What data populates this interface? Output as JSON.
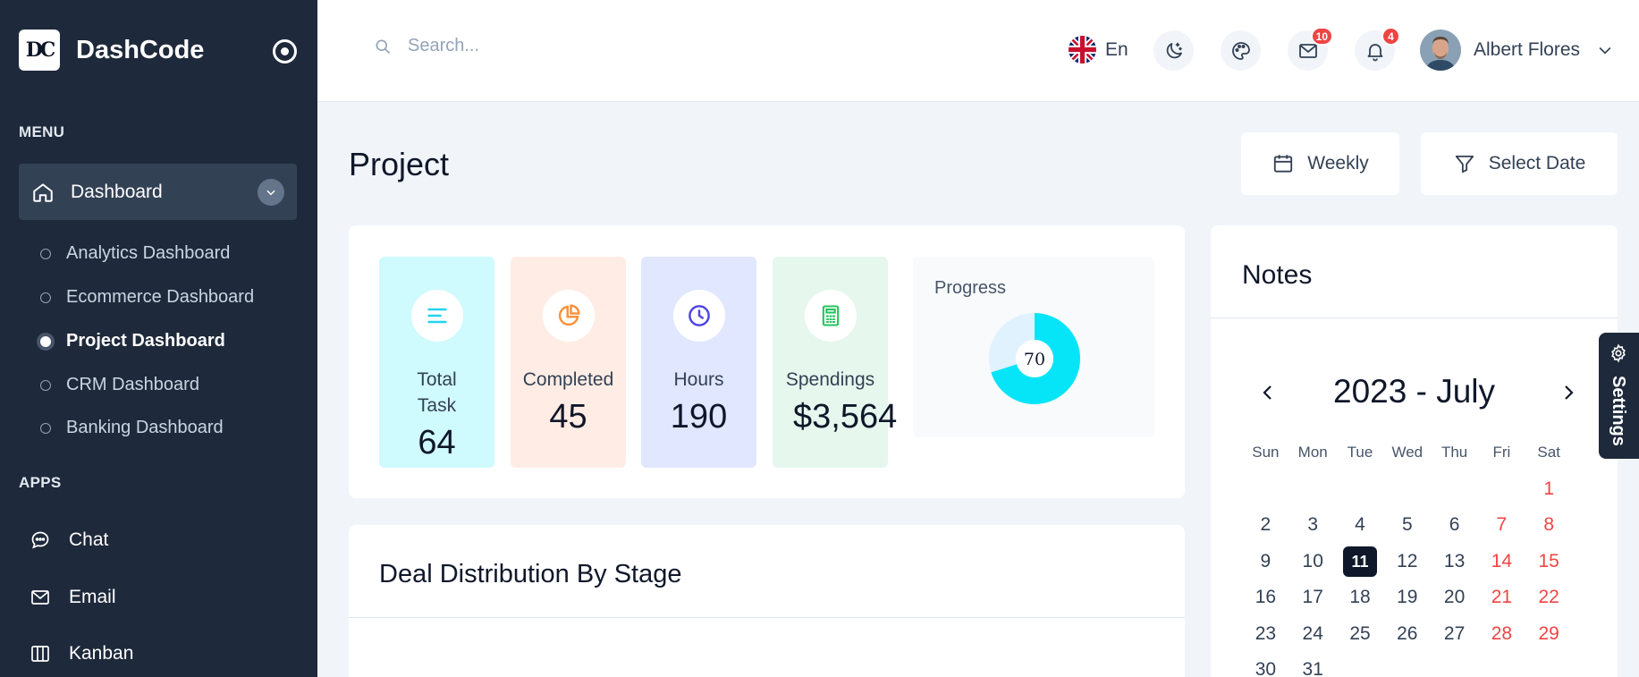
{
  "brand": {
    "logo_text": "DC",
    "name": "DashCode"
  },
  "sidebar": {
    "menu_title": "MENU",
    "dashboard_label": "Dashboard",
    "sub_items": [
      {
        "label": "Analytics Dashboard"
      },
      {
        "label": "Ecommerce Dashboard"
      },
      {
        "label": "Project Dashboard",
        "active": true
      },
      {
        "label": "CRM Dashboard"
      },
      {
        "label": "Banking Dashboard"
      }
    ],
    "apps_title": "APPS",
    "apps": [
      {
        "label": "Chat",
        "icon": "chat-icon"
      },
      {
        "label": "Email",
        "icon": "mail-icon"
      },
      {
        "label": "Kanban",
        "icon": "kanban-icon"
      }
    ]
  },
  "header": {
    "search_placeholder": "Search...",
    "language": "En",
    "mail_count": "10",
    "notification_count": "4",
    "user_name": "Albert Flores"
  },
  "page": {
    "title": "Project",
    "weekly_label": "Weekly",
    "select_date_label": "Select Date"
  },
  "stats": [
    {
      "label": "Total Task",
      "value": "64",
      "bg": "#cffafe",
      "icon": "list-icon",
      "icon_color": "#22d3ee"
    },
    {
      "label": "Completed",
      "value": "45",
      "bg": "#ffede5",
      "icon": "pie-chart-icon",
      "icon_color": "#fb923c"
    },
    {
      "label": "Hours",
      "value": "190",
      "bg": "#e0e7ff",
      "icon": "clock-icon",
      "icon_color": "#4f46e5"
    },
    {
      "label": "Spendings",
      "value": "$3,564",
      "bg": "#e6f7ee",
      "icon": "calculator-icon",
      "icon_color": "#22c55e"
    }
  ],
  "progress": {
    "label": "Progress",
    "value": "70",
    "percent": 70,
    "color": "#06e5f8",
    "track": "#e0f2fe"
  },
  "deal": {
    "title": "Deal Distribution By Stage"
  },
  "notes": {
    "title": "Notes",
    "calendar_title": "2023 - July",
    "days_of_week": [
      "Sun",
      "Mon",
      "Tue",
      "Wed",
      "Thu",
      "Fri",
      "Sat"
    ],
    "weeks": [
      [
        "",
        "",
        "",
        "",
        "",
        "",
        "1"
      ],
      [
        "2",
        "3",
        "4",
        "5",
        "6",
        "7",
        "8"
      ],
      [
        "9",
        "10",
        "11",
        "12",
        "13",
        "14",
        "15"
      ],
      [
        "16",
        "17",
        "18",
        "19",
        "20",
        "21",
        "22"
      ],
      [
        "23",
        "24",
        "25",
        "26",
        "27",
        "28",
        "29"
      ],
      [
        "30",
        "31",
        "",
        "",
        "",
        "",
        ""
      ]
    ],
    "today": "11"
  },
  "settings_label": "Settings"
}
